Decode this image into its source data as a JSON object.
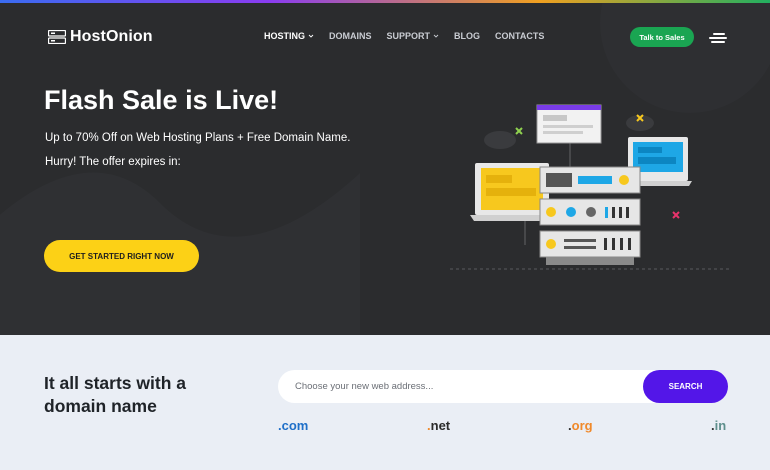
{
  "header": {
    "logo_text": "HostOnion",
    "nav": [
      {
        "label": "HOSTING",
        "has_dropdown": true,
        "active": true
      },
      {
        "label": "DOMAINS",
        "has_dropdown": false,
        "active": false
      },
      {
        "label": "SUPPORT",
        "has_dropdown": true,
        "active": false
      },
      {
        "label": "BLOG",
        "has_dropdown": false,
        "active": false
      },
      {
        "label": "CONTACTS",
        "has_dropdown": false,
        "active": false
      }
    ],
    "talk_button": "Talk to Sales",
    "menu_icon": "hamburger-icon"
  },
  "hero": {
    "title": "Flash Sale is Live!",
    "subtitle": "Up to 70% Off on Web Hosting Plans + Free Domain Name.",
    "timer_text": "Hurry! The offer expires in:",
    "cta_label": "GET STARTED RIGHT NOW",
    "illustration": "server-hosting-illustration"
  },
  "domain": {
    "heading": "It all starts with a domain name",
    "search_placeholder": "Choose your new web address...",
    "search_value": "",
    "search_button": "SEARCH",
    "tlds": [
      {
        "ext": "com",
        "color": "#1f6fc8"
      },
      {
        "ext": "net",
        "color": "#2b2b2b"
      },
      {
        "ext": "org",
        "color": "#f0892a"
      },
      {
        "ext": "in",
        "color": "#5e8f8c"
      }
    ]
  },
  "colors": {
    "hero_bg": "#2b2c2e",
    "accent_green": "#1aa552",
    "cta_yellow": "#fcd116",
    "search_purple": "#5316e8",
    "section_bg": "#eaeef5"
  }
}
